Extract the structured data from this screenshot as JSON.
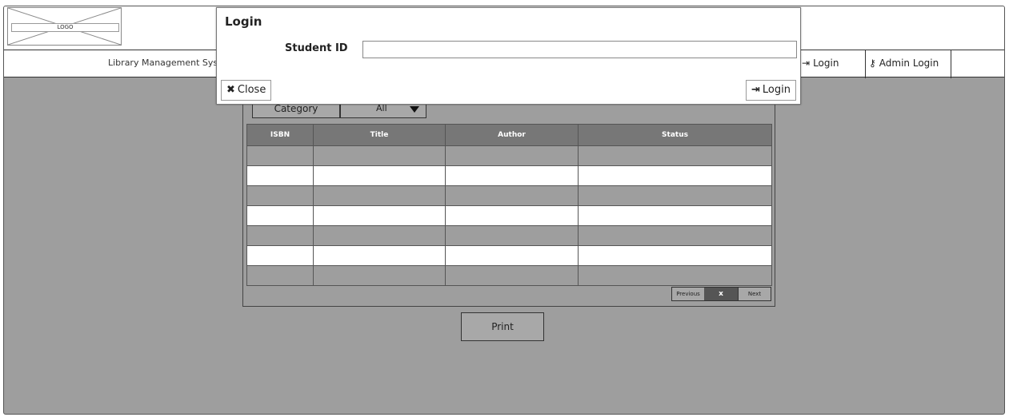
{
  "logo": {
    "label": "LOGO"
  },
  "nav": {
    "title": "Library Management System",
    "login_label": "Login",
    "admin_login_label": "Admin Login"
  },
  "filter": {
    "category_label": "Category",
    "selected_value": "All"
  },
  "table": {
    "columns": [
      "ISBN",
      "Title",
      "Author",
      "Status"
    ],
    "rows": [
      [
        "",
        "",
        "",
        ""
      ],
      [
        "",
        "",
        "",
        ""
      ],
      [
        "",
        "",
        "",
        ""
      ],
      [
        "",
        "",
        "",
        ""
      ],
      [
        "",
        "",
        "",
        ""
      ],
      [
        "",
        "",
        "",
        ""
      ],
      [
        "",
        "",
        "",
        ""
      ]
    ]
  },
  "pagination": {
    "previous_label": "Previous",
    "current_label": "x",
    "next_label": "Next"
  },
  "print_label": "Print",
  "modal": {
    "title": "Login",
    "student_id_label": "Student ID",
    "student_id_value": "",
    "close_label": "Close",
    "login_label": "Login"
  }
}
